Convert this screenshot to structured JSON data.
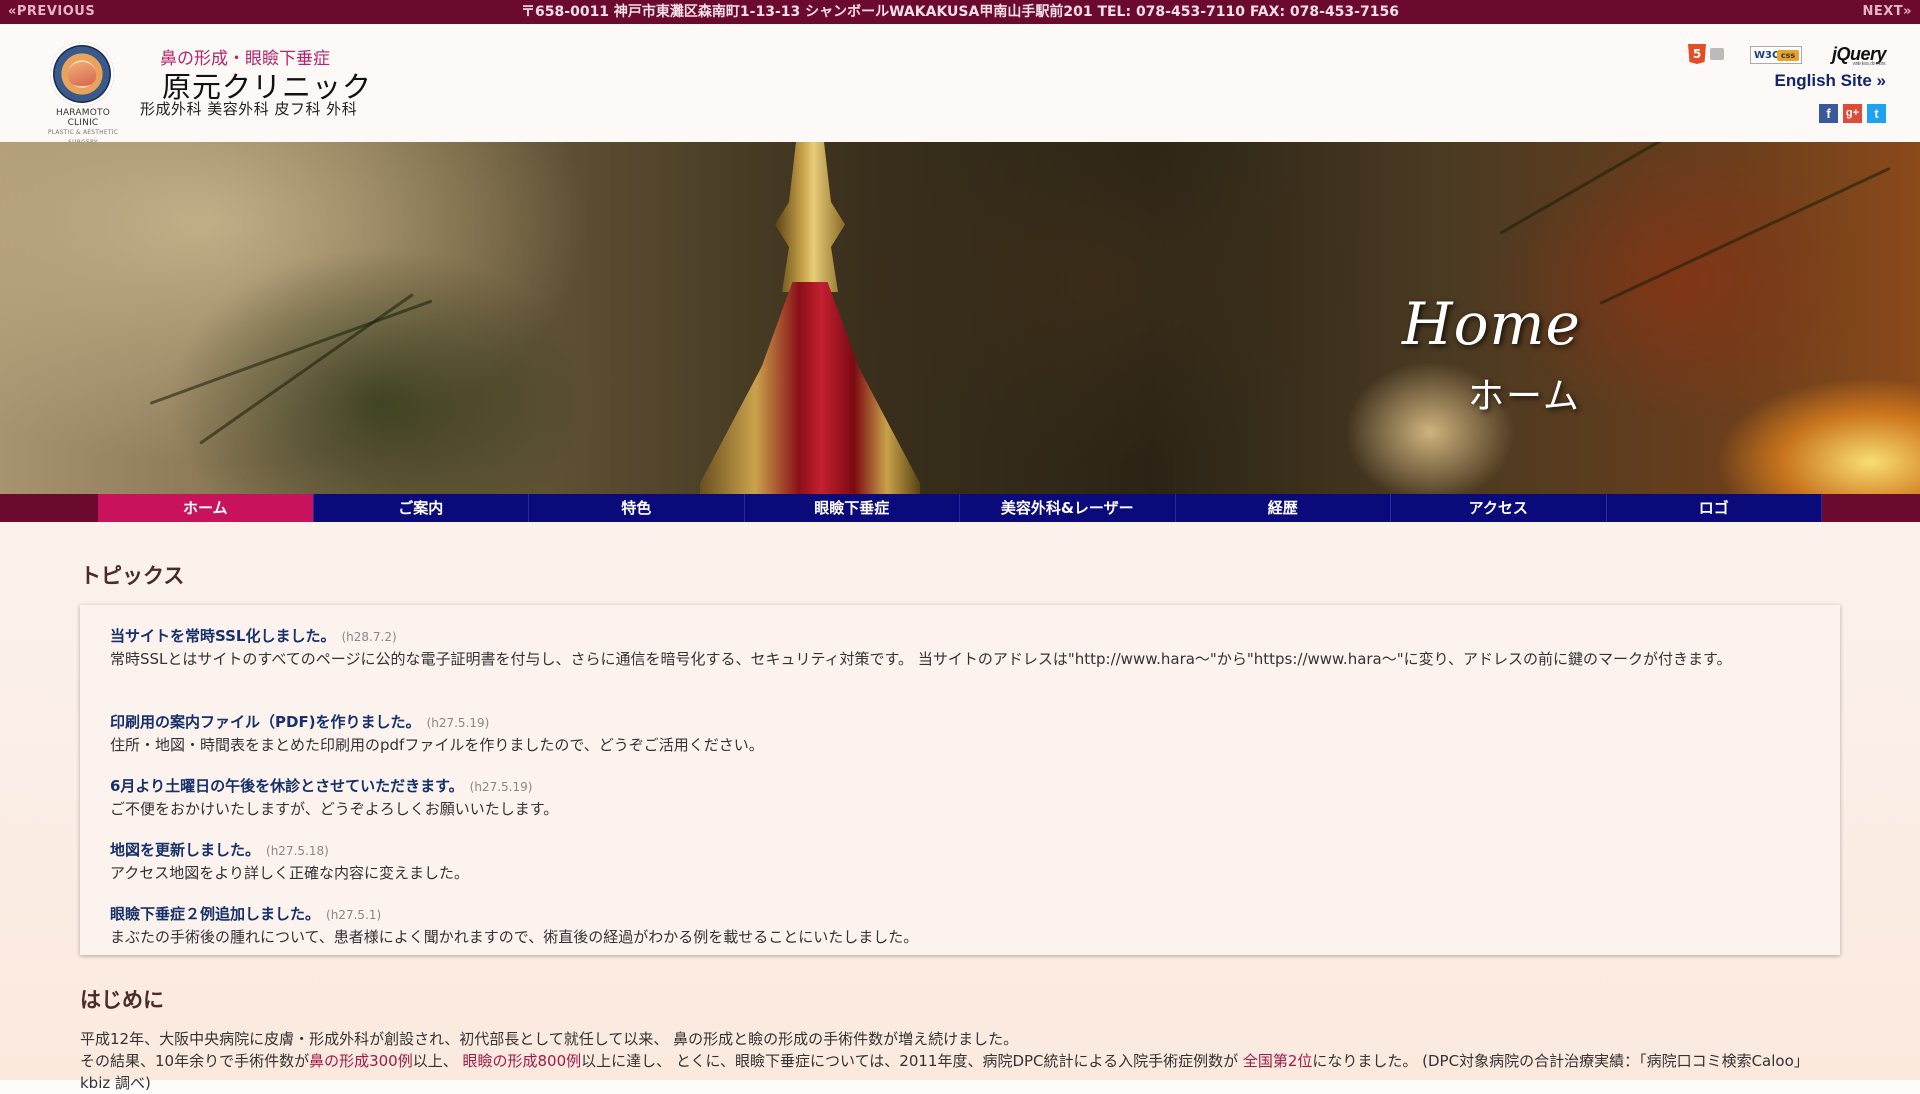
{
  "topbar": {
    "prev": "«PREVIOUS",
    "next": "NEXT»",
    "address": "〒658-0011 神戸市東灘区森南町1-13-13 シャンボールWAKAKUSA甲南山手駅前201 TEL: 078-453-7110 FAX: 078-453-7156"
  },
  "header": {
    "logo_caption": "HARAMOTO CLINIC",
    "logo_caption_sub": "PLASTIC & AESTHETIC SURGERY",
    "tagline": "鼻の形成・眼瞼下垂症",
    "clinic_name": "原元クリニック",
    "departments": "形成外科 美容外科 皮フ科 外科",
    "badge_html5": "5",
    "badge_css": "W3C",
    "badge_css_sub": "css",
    "badge_jquery": "jQuery",
    "badge_jquery_sub": "write less, do more.",
    "english_site": "English Site »",
    "social": {
      "facebook": "f",
      "googleplus": "g+",
      "twitter": "t"
    }
  },
  "hero": {
    "title": "Home",
    "subtitle": "ホーム"
  },
  "nav": {
    "items": [
      {
        "label": "ホーム",
        "active": true
      },
      {
        "label": "ご案内"
      },
      {
        "label": "特色"
      },
      {
        "label": "眼瞼下垂症"
      },
      {
        "label": "美容外科&レーザー"
      },
      {
        "label": "経歴"
      },
      {
        "label": "アクセス"
      },
      {
        "label": "ロゴ"
      }
    ]
  },
  "topics": {
    "heading": "トピックス",
    "items": [
      {
        "title": "当サイトを常時SSL化しました。",
        "date": "(h28.7.2)",
        "body": "常時SSLとはサイトのすべてのページに公的な電子証明書を付与し、さらに通信を暗号化する、セキュリティ対策です。 当サイトのアドレスは\"http://www.hara～\"から\"https://www.hara～\"に変り、アドレスの前に鍵のマークが付きます。"
      },
      {
        "title": "印刷用の案内ファイル（PDF)を作りました。",
        "date": "(h27.5.19)",
        "body": "住所・地図・時間表をまとめた印刷用のpdfファイルを作りましたので、どうぞご活用ください。"
      },
      {
        "title": "6月より土曜日の午後を休診とさせていただきます。",
        "date": "(h27.5.19)",
        "body": "ご不便をおかけいたしますが、どうぞよろしくお願いいたします。"
      },
      {
        "title": "地図を更新しました。",
        "date": "(h27.5.18)",
        "body": "アクセス地図をより詳しく正確な内容に変えました。"
      },
      {
        "title": "眼瞼下垂症２例追加しました。",
        "date": "(h27.5.1)",
        "body": "まぶたの手術後の腫れについて、患者様によく聞かれますので、術直後の経過がわかる例を載せることにいたしました。"
      }
    ]
  },
  "intro": {
    "heading": "はじめに",
    "line1": "平成12年、大阪中央病院に皮膚・形成外科が創設され、初代部長として就任して以来、 鼻の形成と瞼の形成の手術件数が増え続けました。",
    "line2_a": "その結果、10年余りで手術件数が",
    "line2_hl1": "鼻の形成300例",
    "line2_b": "以上、 ",
    "line2_hl2": "眼瞼の形成800例",
    "line2_c": "以上に達し、 とくに、眼瞼下垂症については、2011年度、病院DPC統計による入院手術症例数が ",
    "line2_hl3": "全国第2位",
    "line2_d": "になりました。 (DPC対象病院の合計治療実績：「病院口コミ検索Caloo」 kbiz 調べ)"
  }
}
